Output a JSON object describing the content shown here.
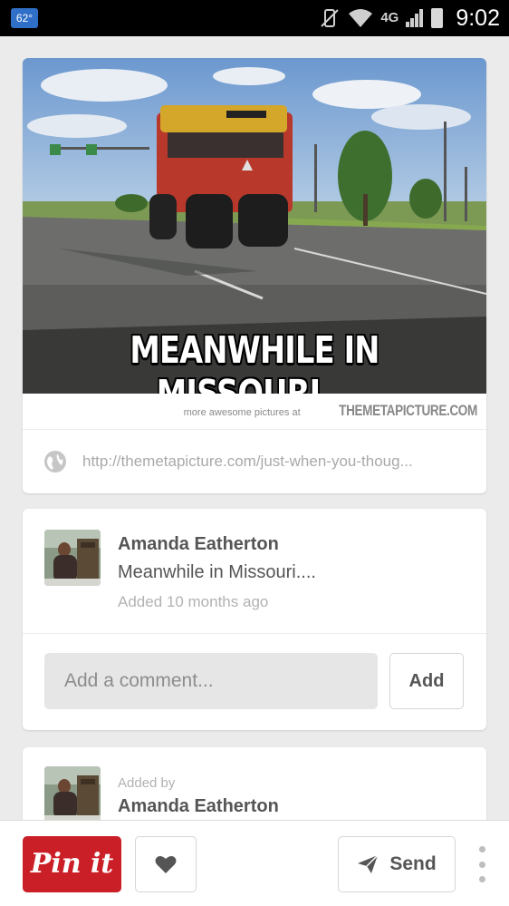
{
  "status_bar": {
    "temperature": "62°",
    "network_label": "4G",
    "time": "9:02"
  },
  "pin": {
    "meme_caption": "MEANWHILE IN MISSOURI...",
    "credit_prefix": "more awesome pictures at",
    "credit_site": "THEMETAPICTURE.COM",
    "source_url": "http://themetapicture.com/just-when-you-thoug..."
  },
  "details": {
    "user_name": "Amanda Eatherton",
    "description": "Meanwhile in Missouri....",
    "added_time": "Added 10 months ago"
  },
  "comment": {
    "placeholder": "Add a comment...",
    "add_label": "Add"
  },
  "added_by": {
    "label": "Added by",
    "user_name": "Amanda Eatherton"
  },
  "action_bar": {
    "pin_it_label": "Pin it",
    "send_label": "Send"
  },
  "colors": {
    "pin_it_red": "#cb1f27",
    "status_badge_blue": "#2f6fc8"
  }
}
